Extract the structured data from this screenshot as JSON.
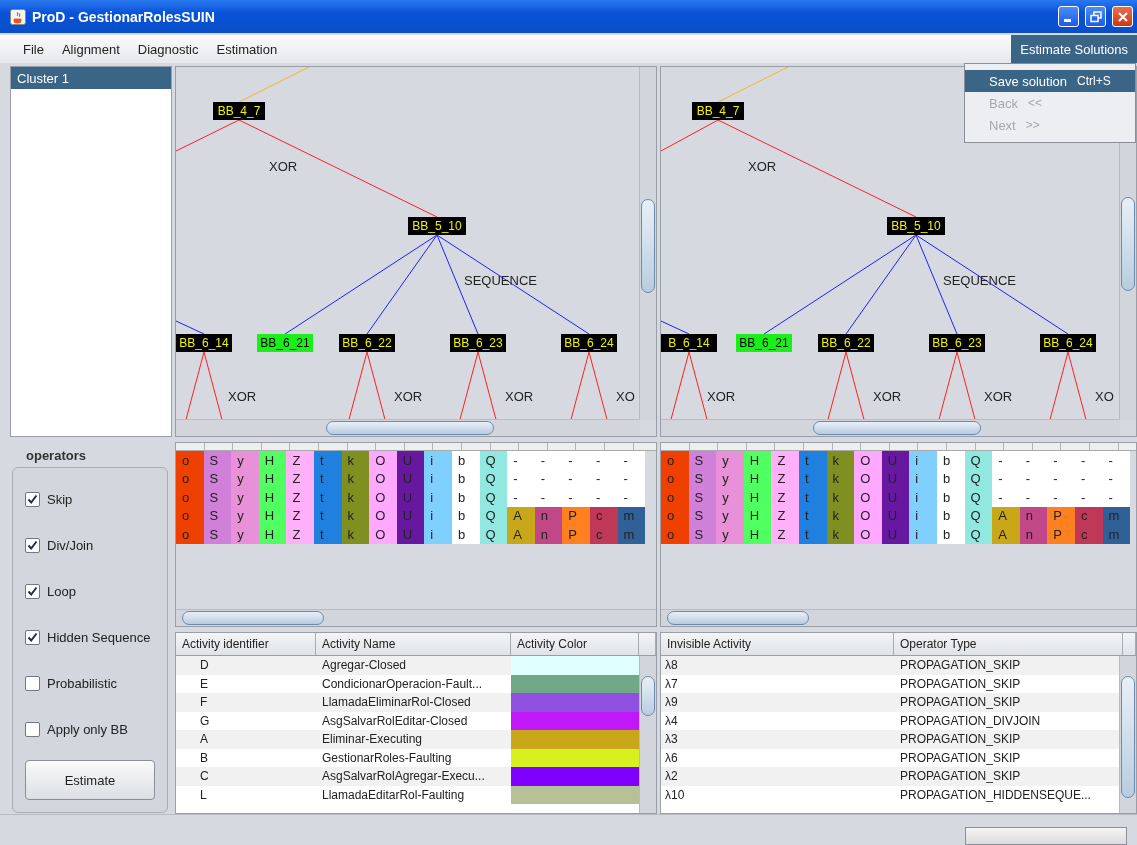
{
  "window": {
    "title": "ProD - GestionarRolesSUIN"
  },
  "menu": [
    {
      "label": "File"
    },
    {
      "label": "Alignment"
    },
    {
      "label": "Diagnostic"
    },
    {
      "label": "Estimation"
    }
  ],
  "solutions_menu": {
    "label": "Estimate Solutions",
    "selected": true,
    "items": [
      {
        "label": "Save solution",
        "shortcut": "Ctrl+S",
        "selected": true,
        "disabled": false
      },
      {
        "label": "Back",
        "shortcut": "<<",
        "selected": false,
        "disabled": true
      },
      {
        "label": "Next",
        "shortcut": ">>",
        "selected": false,
        "disabled": true
      }
    ]
  },
  "clusters": [
    {
      "label": "Cluster 1",
      "selected": true
    }
  ],
  "operators": {
    "title": "operators",
    "options": [
      {
        "label": "Skip",
        "checked": true
      },
      {
        "label": "Div/Join",
        "checked": true
      },
      {
        "label": "Loop",
        "checked": true
      },
      {
        "label": "Hidden Sequence",
        "checked": true
      },
      {
        "label": "Probabilistic",
        "checked": false
      },
      {
        "label": "Apply only BB",
        "checked": false
      }
    ],
    "button": "Estimate"
  },
  "trees": [
    {
      "nodes": [
        {
          "label": "BB_4_7",
          "highlighted": false
        },
        {
          "label": "BB_5_10",
          "highlighted": false
        },
        {
          "label": "BB_6_14",
          "highlighted": false
        },
        {
          "label": "BB_6_21",
          "highlighted": true
        },
        {
          "label": "BB_6_22",
          "highlighted": false
        },
        {
          "label": "BB_6_23",
          "highlighted": false
        },
        {
          "label": "BB_6_24",
          "highlighted": false
        }
      ],
      "operators": [
        "XOR",
        "SEQUENCE",
        "XOR",
        "XOR",
        "XOR",
        "XO"
      ]
    },
    {
      "nodes": [
        {
          "label": "BB_4_7",
          "highlighted": false
        },
        {
          "label": "BB_5_10",
          "highlighted": false
        },
        {
          "label": "B_6_14",
          "highlighted": false
        },
        {
          "label": "BB_6_21",
          "highlighted": true
        },
        {
          "label": "BB_6_22",
          "highlighted": false
        },
        {
          "label": "BB_6_23",
          "highlighted": false
        },
        {
          "label": "BB_6_24",
          "highlighted": false
        }
      ],
      "operators": [
        "XOR",
        "SEQUENCE",
        "XOR",
        "XOR",
        "XOR",
        "XO"
      ]
    }
  ],
  "alignments": [
    {
      "columns": [
        {
          "color": "#f04000",
          "cells": [
            "o",
            "o",
            "o",
            "o",
            "o"
          ]
        },
        {
          "color": "#d080d8",
          "cells": [
            "S",
            "S",
            "S",
            "S",
            "S"
          ]
        },
        {
          "color": "#e890d8",
          "cells": [
            "y",
            "y",
            "y",
            "y",
            "y"
          ]
        },
        {
          "color": "#50ff60",
          "cells": [
            "H",
            "H",
            "H",
            "H",
            "H"
          ]
        },
        {
          "color": "#ffb0f8",
          "cells": [
            "Z",
            "Z",
            "Z",
            "Z",
            "Z"
          ]
        },
        {
          "color": "#2080e0",
          "cells": [
            "t",
            "t",
            "t",
            "t",
            "t"
          ]
        },
        {
          "color": "#809020",
          "cells": [
            "k",
            "k",
            "k",
            "k",
            "k"
          ]
        },
        {
          "color": "#ffa8ff",
          "cells": [
            "O",
            "O",
            "O",
            "O",
            "O"
          ]
        },
        {
          "color": "#6818a0",
          "cells": [
            "U",
            "U",
            "U",
            "U",
            "U"
          ]
        },
        {
          "color": "#80d0ff",
          "cells": [
            "i",
            "i",
            "i",
            "i",
            "i"
          ]
        },
        {
          "color": "#ffffff",
          "cells": [
            "b",
            "b",
            "b",
            "b",
            "b"
          ]
        },
        {
          "color": "#90e8e0",
          "cells": [
            "Q",
            "Q",
            "Q",
            "Q",
            "Q"
          ]
        },
        {
          "color": "#c8a818",
          "cells": [
            "-",
            "-",
            "-",
            "A",
            "A"
          ],
          "gap": [
            true,
            true,
            true,
            false,
            false
          ]
        },
        {
          "color": "#c04888",
          "cells": [
            "-",
            "-",
            "-",
            "n",
            "n"
          ],
          "gap": [
            true,
            true,
            true,
            false,
            false
          ]
        },
        {
          "color": "#ff8020",
          "cells": [
            "-",
            "-",
            "-",
            "P",
            "P"
          ],
          "gap": [
            true,
            true,
            true,
            false,
            false
          ]
        },
        {
          "color": "#c03858",
          "cells": [
            "-",
            "-",
            "-",
            "c",
            "c"
          ],
          "gap": [
            true,
            true,
            true,
            false,
            false
          ]
        },
        {
          "color": "#306098",
          "cells": [
            "-",
            "-",
            "-",
            "m",
            "m"
          ],
          "gap": [
            true,
            true,
            true,
            false,
            false
          ]
        }
      ]
    },
    {
      "columns": [
        {
          "color": "#f04000",
          "cells": [
            "o",
            "o",
            "o",
            "o",
            "o"
          ]
        },
        {
          "color": "#d080d8",
          "cells": [
            "S",
            "S",
            "S",
            "S",
            "S"
          ]
        },
        {
          "color": "#e890d8",
          "cells": [
            "y",
            "y",
            "y",
            "y",
            "y"
          ]
        },
        {
          "color": "#50ff60",
          "cells": [
            "H",
            "H",
            "H",
            "H",
            "H"
          ]
        },
        {
          "color": "#ffb0f8",
          "cells": [
            "Z",
            "Z",
            "Z",
            "Z",
            "Z"
          ]
        },
        {
          "color": "#2080e0",
          "cells": [
            "t",
            "t",
            "t",
            "t",
            "t"
          ]
        },
        {
          "color": "#809020",
          "cells": [
            "k",
            "k",
            "k",
            "k",
            "k"
          ]
        },
        {
          "color": "#ffa8ff",
          "cells": [
            "O",
            "O",
            "O",
            "O",
            "O"
          ]
        },
        {
          "color": "#6818a0",
          "cells": [
            "U",
            "U",
            "U",
            "U",
            "U"
          ]
        },
        {
          "color": "#80d0ff",
          "cells": [
            "i",
            "i",
            "i",
            "i",
            "i"
          ]
        },
        {
          "color": "#ffffff",
          "cells": [
            "b",
            "b",
            "b",
            "b",
            "b"
          ]
        },
        {
          "color": "#90e8e0",
          "cells": [
            "Q",
            "Q",
            "Q",
            "Q",
            "Q"
          ]
        },
        {
          "color": "#c8a818",
          "cells": [
            "-",
            "-",
            "-",
            "A",
            "A"
          ],
          "gap": [
            true,
            true,
            true,
            false,
            false
          ]
        },
        {
          "color": "#c04888",
          "cells": [
            "-",
            "-",
            "-",
            "n",
            "n"
          ],
          "gap": [
            true,
            true,
            true,
            false,
            false
          ]
        },
        {
          "color": "#ff8020",
          "cells": [
            "-",
            "-",
            "-",
            "P",
            "P"
          ],
          "gap": [
            true,
            true,
            true,
            false,
            false
          ]
        },
        {
          "color": "#c03858",
          "cells": [
            "-",
            "-",
            "-",
            "c",
            "c"
          ],
          "gap": [
            true,
            true,
            true,
            false,
            false
          ]
        },
        {
          "color": "#306098",
          "cells": [
            "-",
            "-",
            "-",
            "m",
            "m"
          ],
          "gap": [
            true,
            true,
            true,
            false,
            false
          ]
        }
      ]
    }
  ],
  "activity_table": {
    "columns": [
      "Activity identifier",
      "Activity Name",
      "Activity Color"
    ],
    "rows": [
      {
        "id": "D",
        "name": "Agregar-Closed",
        "color": "#e0ffff"
      },
      {
        "id": "E",
        "name": "CondicionarOperacion-Fault...",
        "color": "#70a888"
      },
      {
        "id": "F",
        "name": "LlamadaEliminarRol-Closed",
        "color": "#9050e0"
      },
      {
        "id": "G",
        "name": "AsgSalvarRolEditar-Closed",
        "color": "#c018f8"
      },
      {
        "id": "A",
        "name": "Eliminar-Executing",
        "color": "#c8a818"
      },
      {
        "id": "B",
        "name": "GestionarRoles-Faulting",
        "color": "#d8f020"
      },
      {
        "id": "C",
        "name": "AsgSalvarRolAgregar-Execu...",
        "color": "#8000ff"
      },
      {
        "id": "L",
        "name": "LlamadaEditarRol-Faulting",
        "color": "#b8c098"
      }
    ]
  },
  "invisible_table": {
    "columns": [
      "Invisible Activity",
      "Operator Type"
    ],
    "rows": [
      {
        "activity": "λ8",
        "operator": "PROPAGATION_SKIP"
      },
      {
        "activity": "λ7",
        "operator": "PROPAGATION_SKIP"
      },
      {
        "activity": "λ9",
        "operator": "PROPAGATION_SKIP"
      },
      {
        "activity": "λ4",
        "operator": "PROPAGATION_DIVJOIN"
      },
      {
        "activity": "λ3",
        "operator": "PROPAGATION_SKIP"
      },
      {
        "activity": "λ6",
        "operator": "PROPAGATION_SKIP"
      },
      {
        "activity": "λ2",
        "operator": "PROPAGATION_SKIP"
      },
      {
        "activity": "λ10",
        "operator": "PROPAGATION_HIDDENSEQUE..."
      }
    ]
  },
  "status_bar": {
    "progress": {
      "level": 0
    }
  }
}
